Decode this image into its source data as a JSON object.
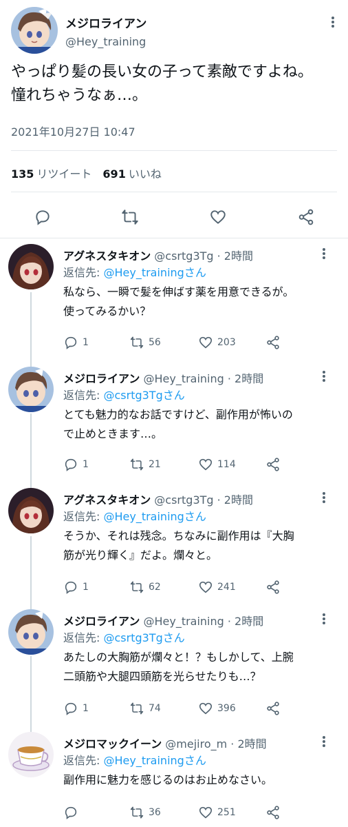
{
  "main_tweet": {
    "author_name": "メジロライアン",
    "author_handle": "@Hey_training",
    "text_line1": "やっぱり髪の長い女の子って素敵ですよね。",
    "text_line2": "憧れちゃうなぁ…。",
    "timestamp": "2021年10月27日 10:47",
    "retweet_count": "135",
    "retweet_label": "リツイート",
    "like_count": "691",
    "like_label": "いいね",
    "icons": [
      "reply-icon",
      "retweet-icon",
      "like-icon",
      "share-icon"
    ]
  },
  "replies": [
    {
      "author_name": "アグネスタキオン",
      "meta": "@csrtg3Tg · 2時間",
      "reply_to_prefix": "返信先: ",
      "reply_to_mention": "@Hey_trainingさん",
      "text_line1": "私なら、一瞬で髪を伸ばす薬を用意できるが。",
      "text_line2": "使ってみるかい？",
      "reply_count": "1",
      "retweet_count": "56",
      "like_count": "203",
      "avatar": "takion"
    },
    {
      "author_name": "メジロライアン",
      "meta": "@Hey_training · 2時間",
      "reply_to_prefix": "返信先: ",
      "reply_to_mention": "@csrtg3Tgさん",
      "text_line1": "とても魅力的なお話ですけど、副作用が怖いの",
      "text_line2": "で止めときます…。",
      "reply_count": "1",
      "retweet_count": "21",
      "like_count": "114",
      "avatar": "ryan"
    },
    {
      "author_name": "アグネスタキオン",
      "meta": "@csrtg3Tg · 2時間",
      "reply_to_prefix": "返信先: ",
      "reply_to_mention": "@Hey_trainingさん",
      "text_line1": "そうか、それは残念。ちなみに副作用は『大胸",
      "text_line2": "筋が光り輝く』だよ。爛々と。",
      "reply_count": "1",
      "retweet_count": "62",
      "like_count": "241",
      "avatar": "takion"
    },
    {
      "author_name": "メジロライアン",
      "meta": "@Hey_training · 2時間",
      "reply_to_prefix": "返信先: ",
      "reply_to_mention": "@csrtg3Tgさん",
      "text_line1": "あたしの大胸筋が爛々と！？もしかして、上腕",
      "text_line2": "二頭筋や大腿四頭筋を光らせたりも…？",
      "reply_count": "1",
      "retweet_count": "74",
      "like_count": "396",
      "avatar": "ryan"
    },
    {
      "author_name": "メジロマックイーン",
      "meta": "@mejiro_m · 2時間",
      "reply_to_prefix": "返信先: ",
      "reply_to_mention": "@Hey_trainingさん",
      "text_line1": "副作用に魅力を感じるのはお止めなさい。",
      "text_line2": "",
      "reply_count": "",
      "retweet_count": "36",
      "like_count": "251",
      "avatar": "teacup"
    }
  ],
  "colors": {
    "text": "#0f1419",
    "secondary": "#536471",
    "link": "#1d9bf0",
    "divider": "#e4e8eb",
    "thread_line": "#cfd9de"
  }
}
